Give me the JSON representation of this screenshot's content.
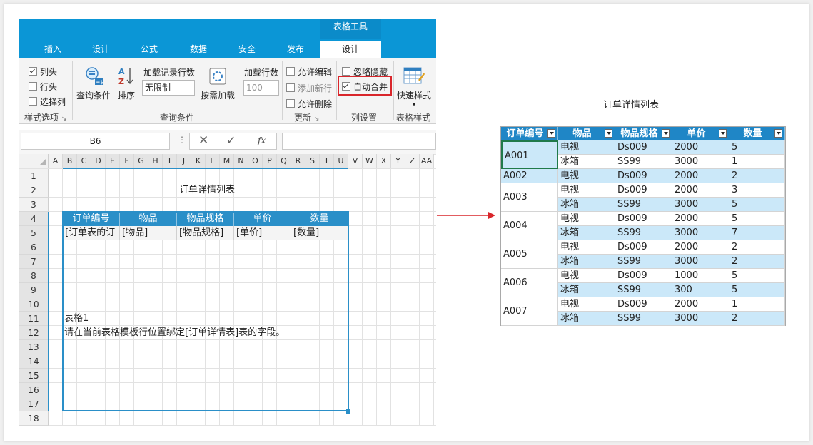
{
  "ribbon": {
    "tool_tab": "表格工具",
    "tabs": [
      "插入",
      "设计",
      "公式",
      "数据",
      "安全",
      "发布",
      "设计"
    ],
    "active_tab_index": 6,
    "style_options": {
      "col_header": "列头",
      "row_header": "行头",
      "select_col": "选择列",
      "col_header_checked": true,
      "row_header_checked": false,
      "select_col_checked": false,
      "group_label": "样式选项"
    },
    "query": {
      "query_condition": "查询条件",
      "sort": "排序",
      "load_rows_label": "加载记录行数",
      "load_rows_value": "无限制",
      "on_demand": "按需加载",
      "load_count_label": "加载行数",
      "load_count_placeholder": "100",
      "group_label": "查询条件"
    },
    "update": {
      "allow_edit": "允许编辑",
      "add_row": "添加新行",
      "allow_delete": "允许删除",
      "group_label": "更新"
    },
    "column": {
      "ignore_hidden": "忽略隐藏",
      "auto_merge": "自动合并",
      "auto_merge_checked": true,
      "group_label": "列设置"
    },
    "table_style": {
      "quick_style": "快速样式",
      "group_label": "表格样式"
    }
  },
  "formula_bar": {
    "cell_ref": "B6",
    "fx": "fx"
  },
  "sheet": {
    "columns": [
      "A",
      "B",
      "C",
      "D",
      "E",
      "F",
      "G",
      "H",
      "I",
      "J",
      "K",
      "L",
      "M",
      "N",
      "O",
      "P",
      "Q",
      "R",
      "S",
      "T",
      "U",
      "V",
      "W",
      "X",
      "Y",
      "Z",
      "AA"
    ],
    "rows": [
      "1",
      "2",
      "3",
      "4",
      "5",
      "6",
      "7",
      "8",
      "9",
      "10",
      "11",
      "12",
      "13",
      "14",
      "15",
      "16",
      "17",
      "18"
    ],
    "title": "订单详情列表",
    "template_headers": [
      "订单编号",
      "物品",
      "物品规格",
      "单价",
      "数量"
    ],
    "template_fields": [
      "[订单表的订",
      "[物品]",
      "[物品规格]",
      "[单价]",
      "[数量]"
    ],
    "table_name": "表格1",
    "table_hint": "请在当前表格模板行位置绑定[订单详情表]表的字段。"
  },
  "result": {
    "title": "订单详情列表",
    "headers": [
      "订单编号",
      "物品",
      "物品规格",
      "单价",
      "数量"
    ],
    "groups": [
      {
        "order": "A001",
        "rows": [
          [
            "电视",
            "Ds009",
            "2000",
            "5"
          ],
          [
            "冰箱",
            "SS99",
            "3000",
            "1"
          ]
        ]
      },
      {
        "order": "A002",
        "rows": [
          [
            "电视",
            "Ds009",
            "2000",
            "2"
          ]
        ]
      },
      {
        "order": "A003",
        "rows": [
          [
            "电视",
            "Ds009",
            "2000",
            "3"
          ],
          [
            "冰箱",
            "SS99",
            "3000",
            "5"
          ]
        ]
      },
      {
        "order": "A004",
        "rows": [
          [
            "电视",
            "Ds009",
            "2000",
            "5"
          ],
          [
            "冰箱",
            "SS99",
            "3000",
            "7"
          ]
        ]
      },
      {
        "order": "A005",
        "rows": [
          [
            "电视",
            "Ds009",
            "2000",
            "2"
          ],
          [
            "冰箱",
            "SS99",
            "3000",
            "2"
          ]
        ]
      },
      {
        "order": "A006",
        "rows": [
          [
            "电视",
            "Ds009",
            "1000",
            "5"
          ],
          [
            "冰箱",
            "SS99",
            "300",
            "5"
          ]
        ]
      },
      {
        "order": "A007",
        "rows": [
          [
            "电视",
            "Ds009",
            "2000",
            "1"
          ],
          [
            "冰箱",
            "SS99",
            "3000",
            "2"
          ]
        ]
      }
    ]
  },
  "colors": {
    "ribbon_blue": "#0b96d6",
    "header_blue": "#1f86c6",
    "band_light": "#cbe8f9",
    "highlight_red": "#d9262b"
  }
}
